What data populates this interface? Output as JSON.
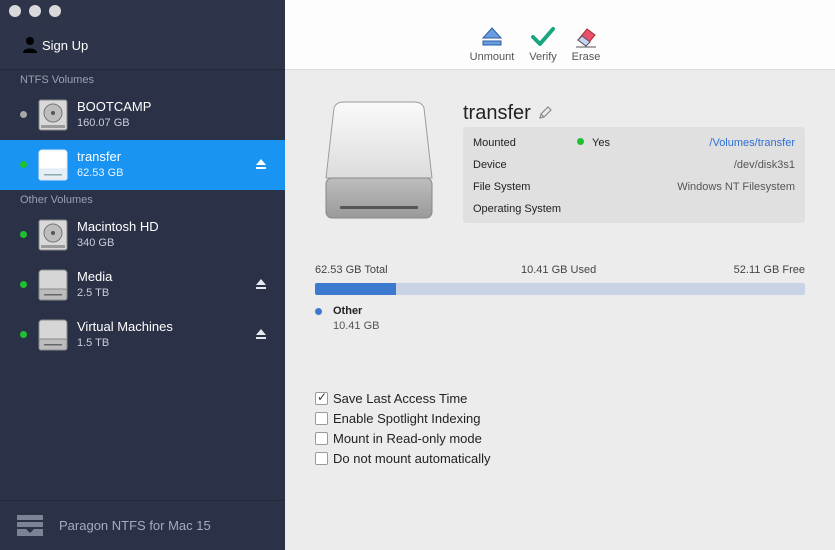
{
  "sidebar": {
    "signup_label": "Sign Up",
    "section_ntfs": "NTFS Volumes",
    "section_other": "Other Volumes",
    "volumes": [
      {
        "name": "BOOTCAMP",
        "size": "160.07 GB",
        "status_color": "#a8a8a8",
        "ejectable": false,
        "icon": "internal-disk-icon"
      },
      {
        "name": "transfer",
        "size": "62.53 GB",
        "status_color": "#20c030",
        "ejectable": true,
        "icon": "external-disk-icon",
        "selected": true
      },
      {
        "name": "Macintosh HD",
        "size": "340 GB",
        "status_color": "#20c030",
        "ejectable": false,
        "icon": "internal-disk-icon"
      },
      {
        "name": "Media",
        "size": "2.5 TB",
        "status_color": "#20c030",
        "ejectable": true,
        "icon": "external-disk-icon"
      },
      {
        "name": "Virtual Machines",
        "size": "1.5 TB",
        "status_color": "#20c030",
        "ejectable": true,
        "icon": "external-disk-icon"
      }
    ],
    "footer_text": "Paragon NTFS for Mac 15"
  },
  "toolbar": {
    "unmount_label": "Unmount",
    "verify_label": "Verify",
    "erase_label": "Erase"
  },
  "detail": {
    "title": "transfer",
    "info": {
      "mounted_key": "Mounted",
      "mounted_value": "Yes",
      "mount_path": "/Volumes/transfer",
      "device_key": "Device",
      "device_value": "/dev/disk3s1",
      "fs_key": "File System",
      "fs_value": "Windows NT Filesystem",
      "os_key": "Operating System",
      "os_value": ""
    },
    "usage": {
      "total": "62.53 GB Total",
      "used": "10.41 GB Used",
      "free": "52.11 GB Free",
      "used_fraction": 0.166,
      "legend_name": "Other",
      "legend_value": "10.41 GB"
    },
    "options": [
      {
        "label": "Save Last Access Time",
        "checked": true
      },
      {
        "label": "Enable Spotlight Indexing",
        "checked": false
      },
      {
        "label": "Mount in Read-only mode",
        "checked": false
      },
      {
        "label": "Do not mount automatically",
        "checked": false
      }
    ]
  },
  "colors": {
    "sidebar_bg": "#2b3146",
    "selected_bg": "#1994f2",
    "accent": "#3c7ad0",
    "mounted_green": "#20c030"
  }
}
